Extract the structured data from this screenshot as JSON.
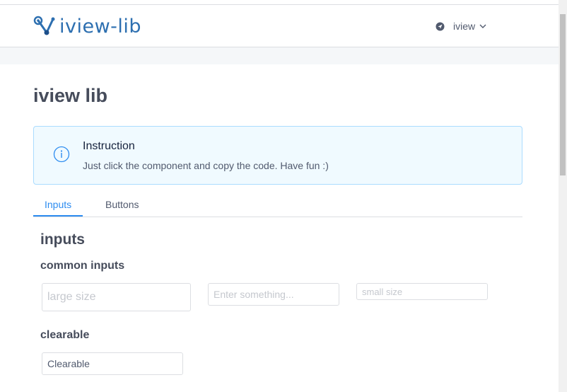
{
  "header": {
    "logo_text": "iview-lib",
    "user_name": "iview",
    "icons": {
      "logo": "graph-node-logo",
      "user": "navigation-arrow-icon",
      "dropdown": "chevron-down-icon"
    }
  },
  "main": {
    "page_title": "iview lib",
    "alert": {
      "title": "Instruction",
      "description": "Just click the component and copy the code. Have fun :)",
      "icon": "info-icon"
    },
    "tabs": [
      {
        "label": "Inputs",
        "active": true
      },
      {
        "label": "Buttons",
        "active": false
      }
    ],
    "section_title": "inputs",
    "common_inputs": {
      "title": "common inputs",
      "large_placeholder": "large size",
      "default_placeholder": "Enter something...",
      "small_placeholder": "small size"
    },
    "clearable": {
      "title": "clearable",
      "value": "Clearable"
    }
  },
  "colors": {
    "primary": "#2d8cf0",
    "logo": "#2d6fb0",
    "alert_bg": "#f0faff",
    "alert_border": "#abdcff",
    "heading": "#464c5b"
  }
}
